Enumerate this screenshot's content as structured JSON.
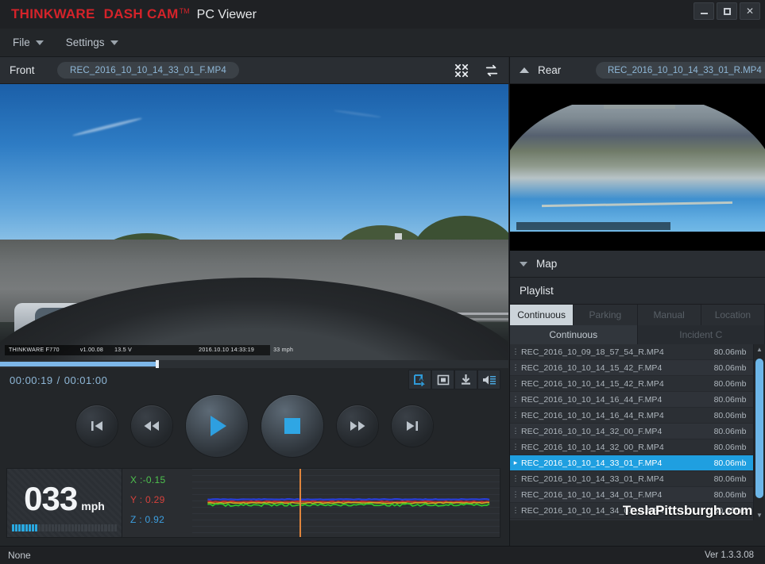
{
  "titlebar": {
    "brand_thinkware": "THINKWARE",
    "brand_dashcam": "DASH CAM",
    "brand_tm": "TM",
    "app_title": "PC Viewer",
    "minimize_label": "",
    "maximize_label": "",
    "close_label": "✕"
  },
  "menubar": {
    "items": [
      {
        "label": "File"
      },
      {
        "label": "Settings"
      }
    ]
  },
  "front": {
    "label": "Front",
    "filename": "REC_2016_10_10_14_33_01_F.MP4",
    "expand_icon": "expand-icon",
    "swap_icon": "swap-channels-icon",
    "overlay": {
      "model": "THINKWARE F770",
      "firmware": "v1.00.08",
      "voltage": "13.5 V",
      "datetime": "2016.10.10 14:33:19",
      "speed": "33 mph"
    }
  },
  "rear": {
    "label": "Rear",
    "filename": "REC_2016_10_10_14_33_01_R.MP4",
    "collapse_icon": "chevron-up-icon"
  },
  "map": {
    "label": "Map",
    "expand_icon": "chevron-down-icon"
  },
  "player": {
    "current_time": "00:00:19",
    "total_time": "00:01:00",
    "time_separator": "/",
    "progress_percent": 31,
    "buttons": {
      "previous": "skip-previous",
      "rewind": "rewind",
      "play": "play",
      "stop": "stop",
      "forward": "fast-forward",
      "next": "skip-next"
    },
    "tools": [
      {
        "name": "text-overlay-toggle",
        "active": true
      },
      {
        "name": "capture-frame",
        "active": false
      },
      {
        "name": "save-download",
        "active": false
      },
      {
        "name": "volume",
        "active": false
      }
    ]
  },
  "telemetry": {
    "speed_value": "033",
    "speed_unit": "mph",
    "speed_bar_filled": 8,
    "speed_bar_total": 32,
    "g_sensor": {
      "x_label": "X :",
      "x_value": "-0.15",
      "y_label": "Y :",
      "y_value": "0.29",
      "z_label": "Z :",
      "z_value": "0.92",
      "x_color": "#4ec24e",
      "y_color": "#d6413c",
      "z_color": "#3d9fe0",
      "playhead_percent": 35
    }
  },
  "playlist": {
    "title": "Playlist",
    "tabs": [
      {
        "label": "Continuous",
        "active": true
      },
      {
        "label": "Parking",
        "active": false
      },
      {
        "label": "Manual",
        "active": false
      },
      {
        "label": "Location",
        "active": false
      }
    ],
    "subtabs": [
      {
        "label": "Continuous",
        "active": true
      },
      {
        "label": "Incident C",
        "active": false
      }
    ],
    "rows": [
      {
        "name": "REC_2016_10_09_18_57_54_R.MP4",
        "size": "80.06mb",
        "selected": false
      },
      {
        "name": "REC_2016_10_10_14_15_42_F.MP4",
        "size": "80.06mb",
        "selected": false
      },
      {
        "name": "REC_2016_10_10_14_15_42_R.MP4",
        "size": "80.06mb",
        "selected": false
      },
      {
        "name": "REC_2016_10_10_14_16_44_F.MP4",
        "size": "80.06mb",
        "selected": false
      },
      {
        "name": "REC_2016_10_10_14_16_44_R.MP4",
        "size": "80.06mb",
        "selected": false
      },
      {
        "name": "REC_2016_10_10_14_32_00_F.MP4",
        "size": "80.06mb",
        "selected": false
      },
      {
        "name": "REC_2016_10_10_14_32_00_R.MP4",
        "size": "80.06mb",
        "selected": false
      },
      {
        "name": "REC_2016_10_10_14_33_01_F.MP4",
        "size": "80.06mb",
        "selected": true
      },
      {
        "name": "REC_2016_10_10_14_33_01_R.MP4",
        "size": "80.06mb",
        "selected": false
      },
      {
        "name": "REC_2016_10_10_14_34_01_F.MP4",
        "size": "80.06mb",
        "selected": false
      },
      {
        "name": "REC_2016_10_10_14_34_01_R.MP4",
        "size": "80.06mb",
        "selected": false
      }
    ],
    "scroll_up_icon": "▲",
    "scroll_down_icon": "▼"
  },
  "watermark": "TeslaPittsburgh.com",
  "statusbar": {
    "left": "None",
    "right": "Ver 1.3.3.08"
  }
}
